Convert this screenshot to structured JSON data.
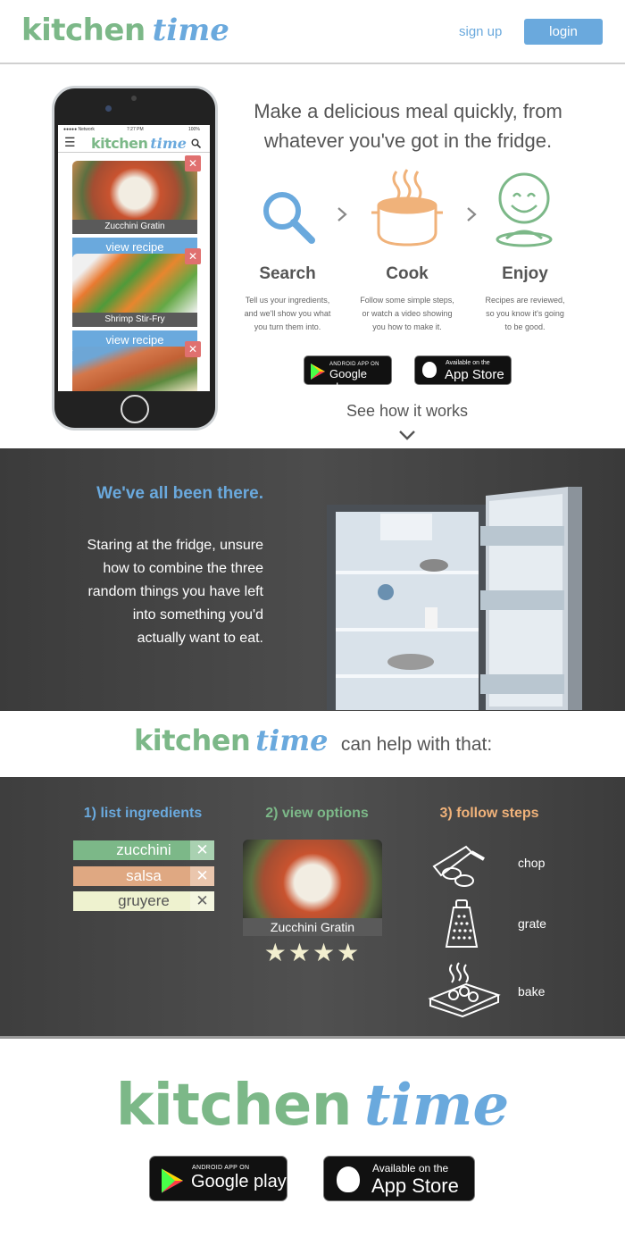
{
  "brand": {
    "word1": "kitchen",
    "word2": "time"
  },
  "header": {
    "signup": "sign up",
    "login": "login"
  },
  "phone": {
    "status_left": "●●●●● Network",
    "status_time": "7:27 PM",
    "status_right": "100%",
    "recipes": [
      {
        "name": "Zucchini Gratin",
        "button": "view recipe"
      },
      {
        "name": "Shrimp Stir-Fry",
        "button": "view recipe"
      },
      {
        "name": "",
        "button": ""
      }
    ],
    "remove_glyph": "✕"
  },
  "hero": {
    "headline_line1": "Make a delicious meal quickly, from",
    "headline_line2": "whatever you've got in the fridge.",
    "steps": [
      {
        "title": "Search",
        "icon": "search-icon",
        "desc1": "Tell us your ingredients,",
        "desc2": "and we'll show you what",
        "desc3": "you turn them into."
      },
      {
        "title": "Cook",
        "icon": "pot-icon",
        "desc1": "Follow some simple steps,",
        "desc2": "or watch a video showing",
        "desc3": "you how to make it."
      },
      {
        "title": "Enjoy",
        "icon": "smiley-icon",
        "desc1": "Recipes are reviewed,",
        "desc2": "so you know it's going",
        "desc3": "to be good."
      }
    ],
    "google_small": "ANDROID APP ON",
    "google_big": "Google play",
    "apple_small": "Available on the",
    "apple_big": "App Store",
    "see_how": "See how it works"
  },
  "fridge_section": {
    "heading": "We've all been there.",
    "lines": [
      "Staring at the fridge, unsure",
      "how to combine the three",
      "random things you have left",
      "into something you'd",
      "actually want to eat."
    ]
  },
  "help": {
    "tagline": "can help with that:"
  },
  "features": {
    "col1_title": "1) list ingredients",
    "col2_title": "2) view options",
    "col3_title": "3) follow steps",
    "ingredients": [
      "zucchini",
      "salsa",
      "gruyere"
    ],
    "remove_glyph": "✕",
    "option_name": "Zucchini Gratin",
    "rating": 4,
    "stars": "★★★★",
    "tools": [
      {
        "label": "chop",
        "icon": "knife-icon"
      },
      {
        "label": "grate",
        "icon": "grater-icon"
      },
      {
        "label": "bake",
        "icon": "baking-dish-icon"
      }
    ]
  },
  "footer": {
    "google_small": "ANDROID APP ON",
    "google_big": "Google play",
    "apple_small": "Available on the",
    "apple_big": "App Store"
  },
  "colors": {
    "green": "#7cb888",
    "blue": "#6aa9dd",
    "orange": "#f0b27a",
    "red": "#e0706f"
  }
}
